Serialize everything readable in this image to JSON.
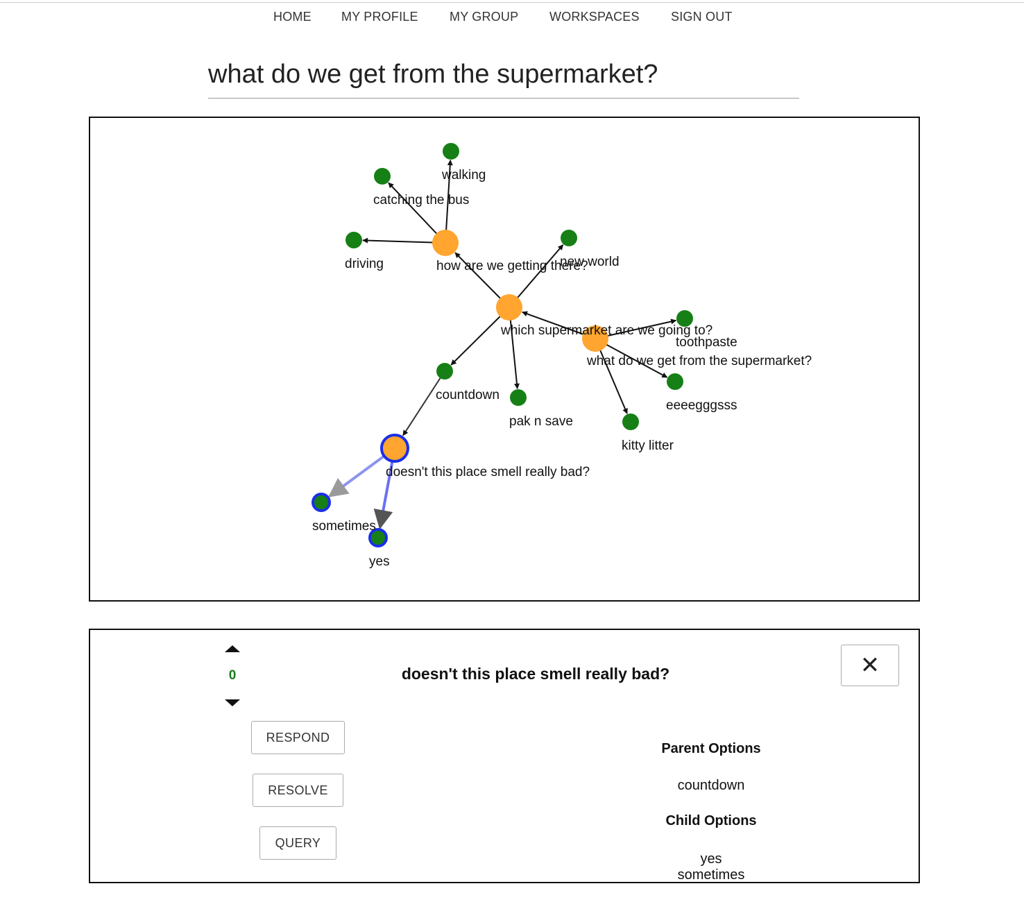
{
  "nav": {
    "items": [
      {
        "label": "HOME"
      },
      {
        "label": "MY PROFILE"
      },
      {
        "label": "MY GROUP"
      },
      {
        "label": "WORKSPACES"
      },
      {
        "label": "SIGN OUT"
      }
    ]
  },
  "page": {
    "title": "what do we get from the supermarket?"
  },
  "colors": {
    "question_node": "#ffa530",
    "answer_node": "#168016",
    "selected_ring": "#1a2fe8",
    "selected_edge": "#8c94f0",
    "edge": "#111111"
  },
  "graph": {
    "nodes": [
      {
        "id": "root",
        "label": "what do we get from the supermarket?",
        "type": "question"
      },
      {
        "id": "which",
        "label": "which supermarket are we going to?",
        "type": "question"
      },
      {
        "id": "how",
        "label": "how are we getting there?",
        "type": "question"
      },
      {
        "id": "smell",
        "label": "doesn't this place smell really bad?",
        "type": "question",
        "selected": true
      },
      {
        "id": "walking",
        "label": "walking",
        "type": "answer"
      },
      {
        "id": "bus",
        "label": "catching the bus",
        "type": "answer"
      },
      {
        "id": "driving",
        "label": "driving",
        "type": "answer"
      },
      {
        "id": "newworld",
        "label": "new world",
        "type": "answer"
      },
      {
        "id": "countdown",
        "label": "countdown",
        "type": "answer"
      },
      {
        "id": "paknsave",
        "label": "pak n save",
        "type": "answer"
      },
      {
        "id": "toothpaste",
        "label": "toothpaste",
        "type": "answer"
      },
      {
        "id": "eggs",
        "label": "eeeegggsss",
        "type": "answer"
      },
      {
        "id": "kitty",
        "label": "kitty litter",
        "type": "answer"
      },
      {
        "id": "sometimes",
        "label": "sometimes",
        "type": "answer",
        "selected": true
      },
      {
        "id": "yes",
        "label": "yes",
        "type": "answer",
        "selected": true
      }
    ],
    "edges": [
      {
        "from": "root",
        "to": "which"
      },
      {
        "from": "root",
        "to": "toothpaste"
      },
      {
        "from": "root",
        "to": "eggs"
      },
      {
        "from": "root",
        "to": "kitty"
      },
      {
        "from": "which",
        "to": "how"
      },
      {
        "from": "which",
        "to": "newworld"
      },
      {
        "from": "which",
        "to": "countdown"
      },
      {
        "from": "which",
        "to": "paknsave"
      },
      {
        "from": "how",
        "to": "walking"
      },
      {
        "from": "how",
        "to": "bus"
      },
      {
        "from": "how",
        "to": "driving"
      },
      {
        "from": "countdown",
        "to": "smell"
      },
      {
        "from": "smell",
        "to": "sometimes",
        "selected": true
      },
      {
        "from": "smell",
        "to": "yes",
        "selected": true
      }
    ]
  },
  "panel": {
    "vote_count": "0",
    "title": "doesn't this place smell really bad?",
    "close_label": "✕",
    "buttons": {
      "respond": "RESPOND",
      "resolve": "RESOLVE",
      "query": "QUERY"
    },
    "parent_heading": "Parent Options",
    "parent_options": [
      "countdown"
    ],
    "child_heading": "Child Options",
    "child_options": [
      "yes",
      "sometimes"
    ]
  }
}
